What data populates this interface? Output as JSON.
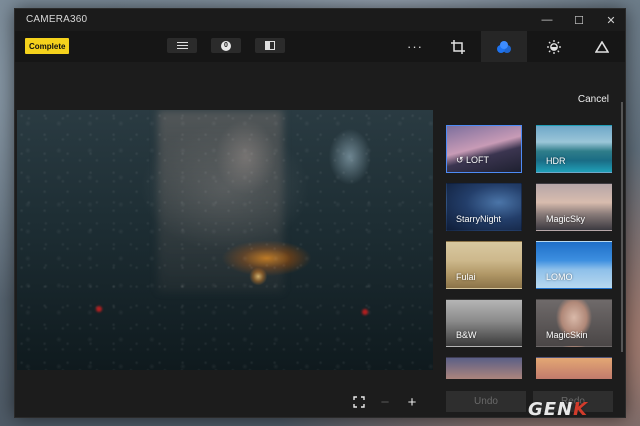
{
  "window": {
    "title": "CAMERA360",
    "minimize_glyph": "—",
    "maximize_glyph": "☐",
    "close_glyph": "✕"
  },
  "toolbar": {
    "complete_label": "Complete",
    "history_count": "0",
    "more_glyph": "···",
    "icons": [
      "menu-icon",
      "history-count",
      "compare-icon",
      "more-icon",
      "crop-icon",
      "filter-icon",
      "brightness-icon",
      "sharpen-icon"
    ],
    "active_tool": "filter",
    "accent_color": "#f5d21c",
    "active_icon_color": "#1e73f0"
  },
  "panel": {
    "cancel_label": "Cancel",
    "filters": [
      {
        "label": "LOFT",
        "selected": true,
        "icon": "undo-icon"
      },
      {
        "label": "HDR",
        "selected": false
      },
      {
        "label": "StarryNight",
        "selected": false
      },
      {
        "label": "MagicSky",
        "selected": false
      },
      {
        "label": "Fulai",
        "selected": false
      },
      {
        "label": "LOMO",
        "selected": false
      },
      {
        "label": "B&W",
        "selected": false
      },
      {
        "label": "MagicSkin",
        "selected": false
      },
      {
        "label": "",
        "selected": false
      },
      {
        "label": "",
        "selected": false
      }
    ],
    "undo_label": "Undo",
    "redo_label": "Redo"
  },
  "image_controls": {
    "fit_icon": "fit-screen-icon",
    "zoom_out_glyph": "−",
    "zoom_in_glyph": "+"
  },
  "watermark": {
    "text_a": "GEN",
    "text_b": "K"
  }
}
